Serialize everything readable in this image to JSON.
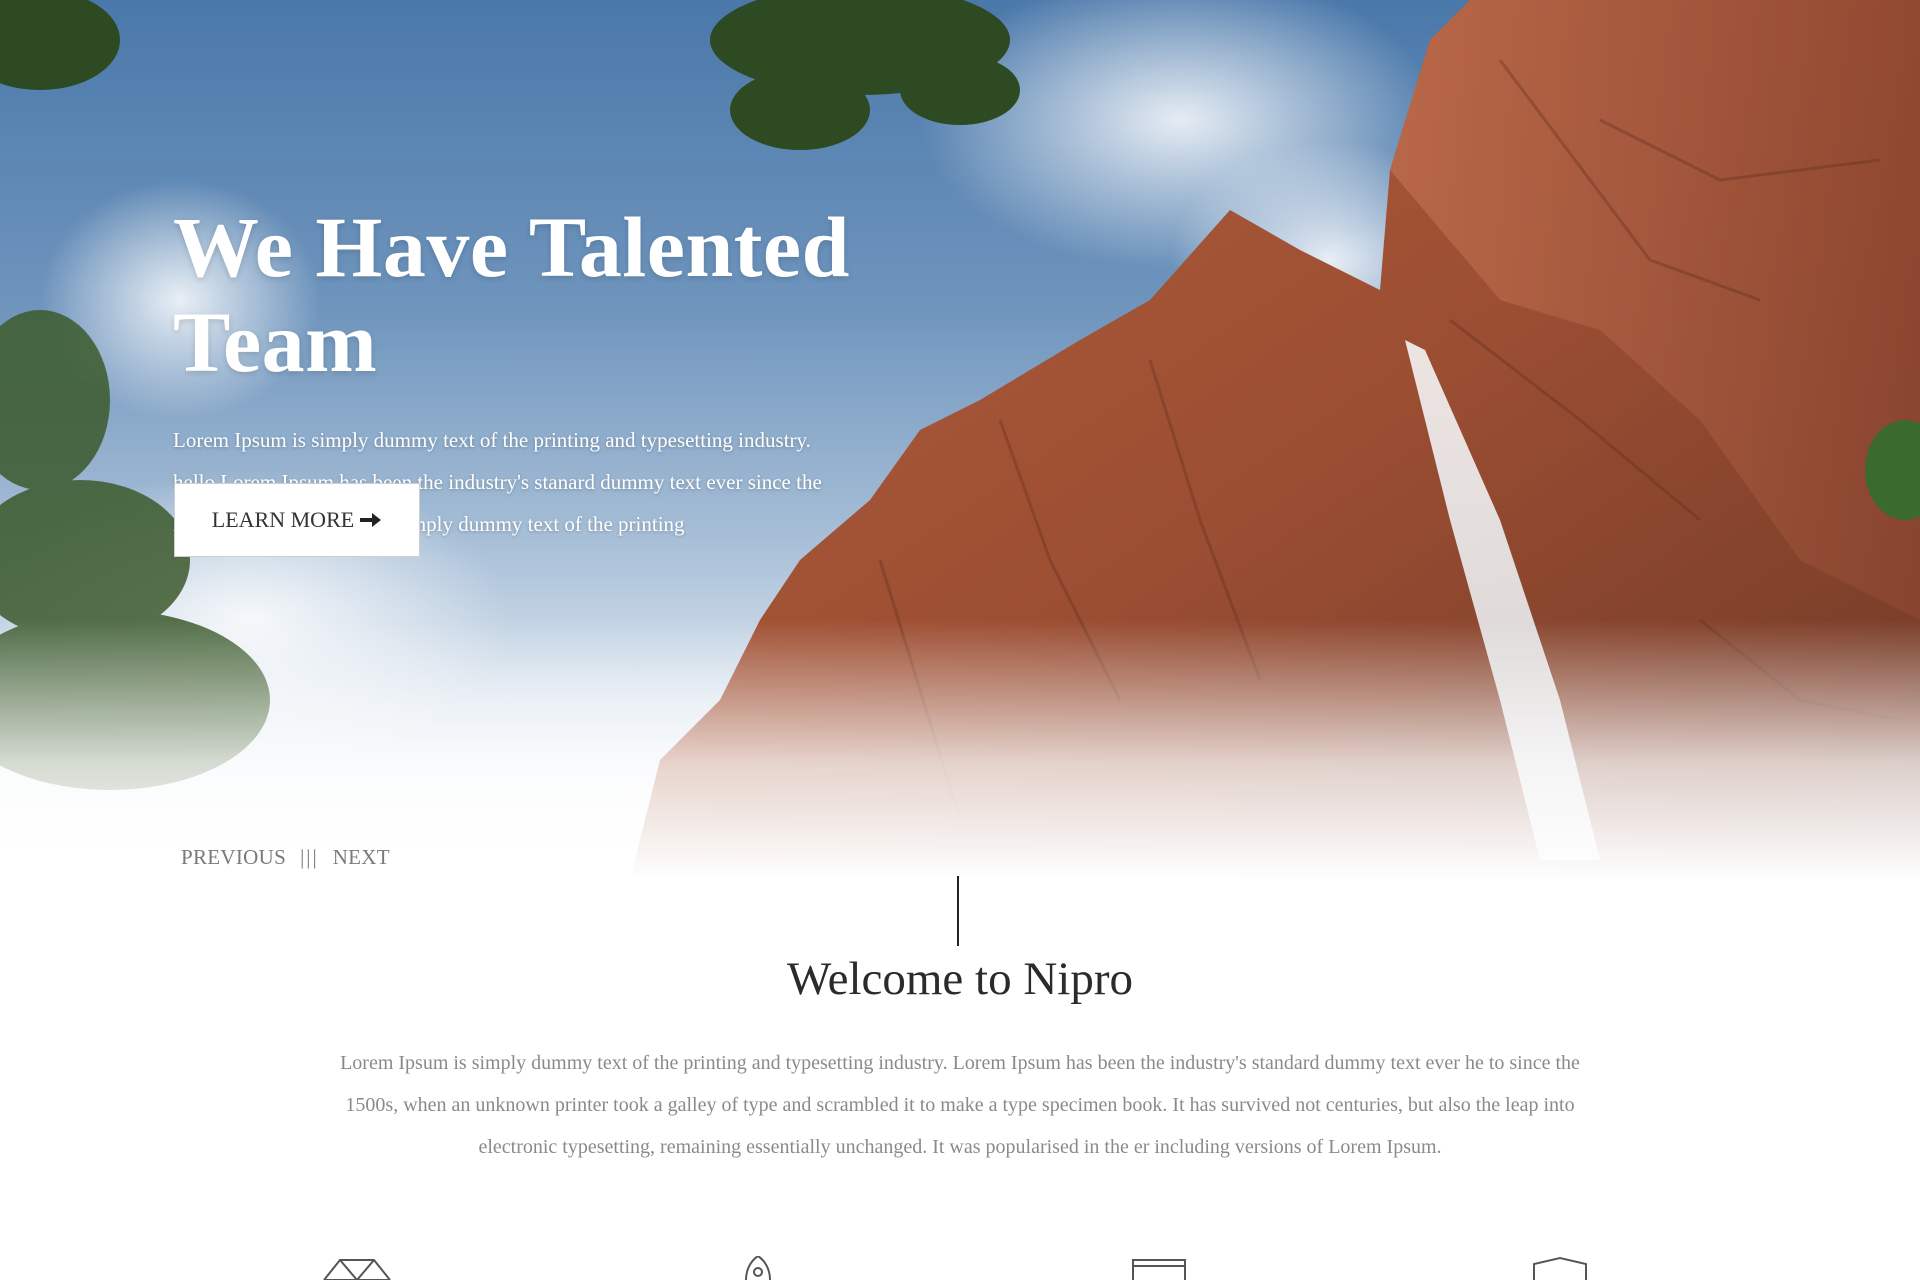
{
  "hero": {
    "title": "We Have Talented Team",
    "text_lines": [
      "Lorem Ipsum is simply dummy text of the printing and typesetting industry.",
      "hello Lorem Ipsum has been the industry's stanard dummy text ever since the",
      "hello bossLorem Ipsum is simply dummy text of the printing"
    ],
    "button_label": "LEARN MORE",
    "button_icon": "arrow-right-icon"
  },
  "slider_nav": {
    "previous_label": "PREVIOUS",
    "separator": "|||",
    "next_label": "NEXT"
  },
  "welcome": {
    "title": "Welcome to Nipro",
    "text_lines": [
      "Lorem Ipsum is simply dummy text of the printing and typesetting industry. Lorem Ipsum has been the industry's standard dummy text ever he to since the",
      "1500s, when an unknown printer took a galley of type and scrambled it to make a type specimen book. It has survived not centuries, but also the leap into",
      "electronic typesetting, remaining essentially unchanged. It was popularised in the er including versions of Lorem Ipsum."
    ]
  },
  "features": {
    "icons": [
      "diamond-icon",
      "rocket-icon",
      "monitor-icon",
      "shield-icon"
    ]
  },
  "colors": {
    "sky": "#6f95bd",
    "rock": "#a5573a",
    "heading": "#2b2b2b",
    "body_text": "#8a8a8a",
    "nav_text": "#7a7a7a"
  }
}
